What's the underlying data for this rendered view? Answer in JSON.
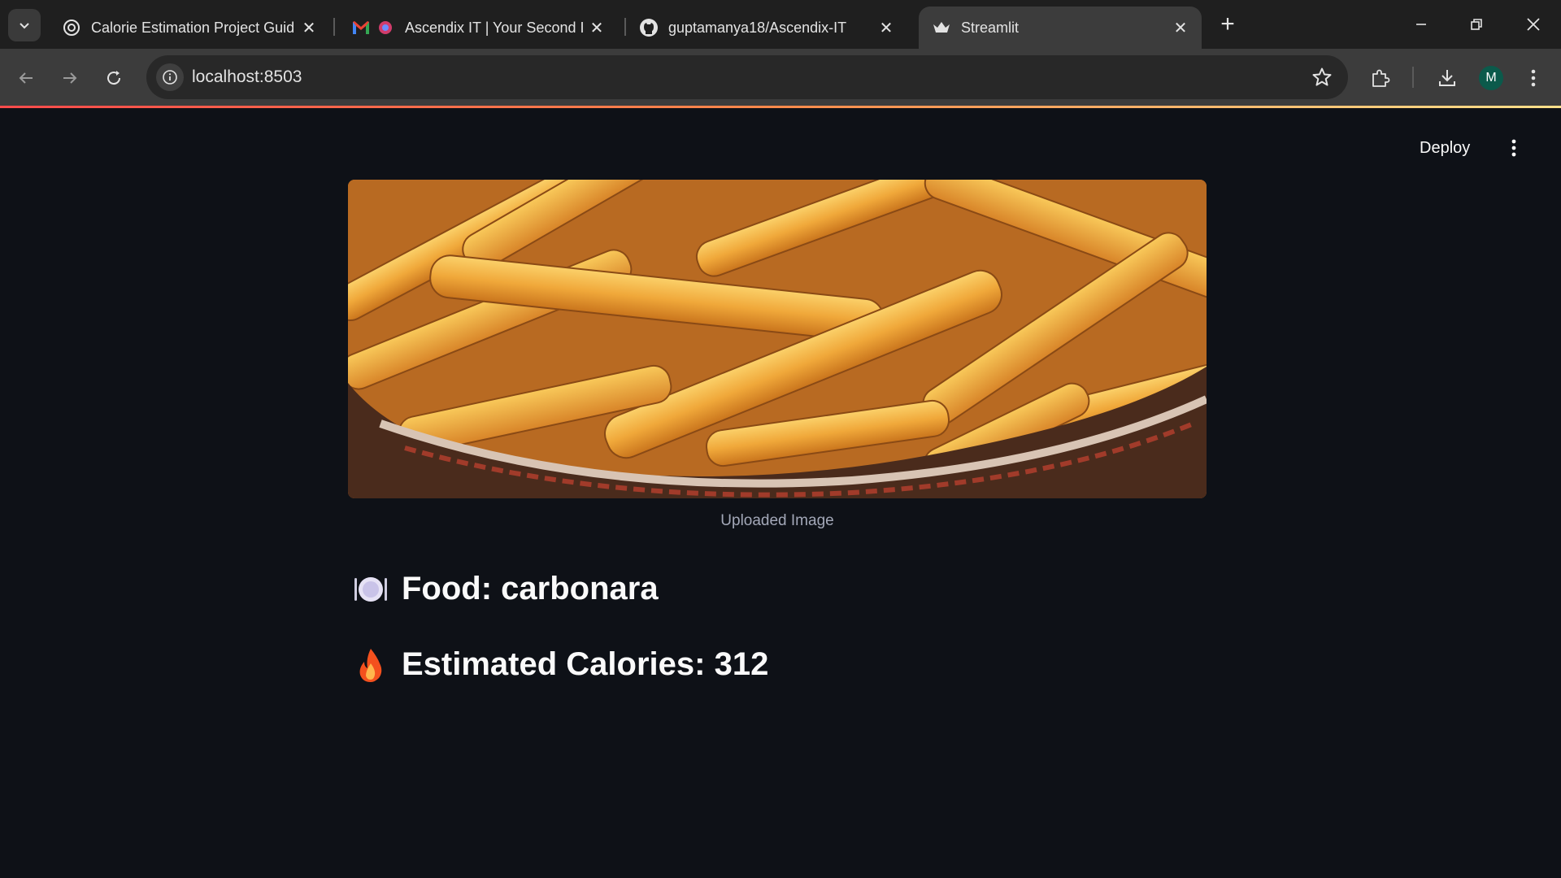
{
  "browser": {
    "tabs": [
      {
        "title": "Calorie Estimation Project Guide",
        "favicon": "chatgpt-icon",
        "active": false
      },
      {
        "title": "Ascendix IT | Your Second In",
        "favicon": "gmail-icon",
        "active": false
      },
      {
        "title": "guptamanya18/Ascendix-IT",
        "favicon": "github-icon",
        "active": false
      },
      {
        "title": "Streamlit",
        "favicon": "streamlit-icon",
        "active": true
      }
    ],
    "url": "localhost:8503",
    "profile_initial": "M"
  },
  "app": {
    "deploy_label": "Deploy",
    "image_caption": "Uploaded Image",
    "food_label": "Food: carbonara",
    "calories_label": "Estimated Calories: 312"
  },
  "colors": {
    "app_background": "#0e1117",
    "text": "#fafafa",
    "caption": "#a3a8b8",
    "accent_gradient": [
      "#ff4b4b",
      "#ffe08a"
    ]
  }
}
